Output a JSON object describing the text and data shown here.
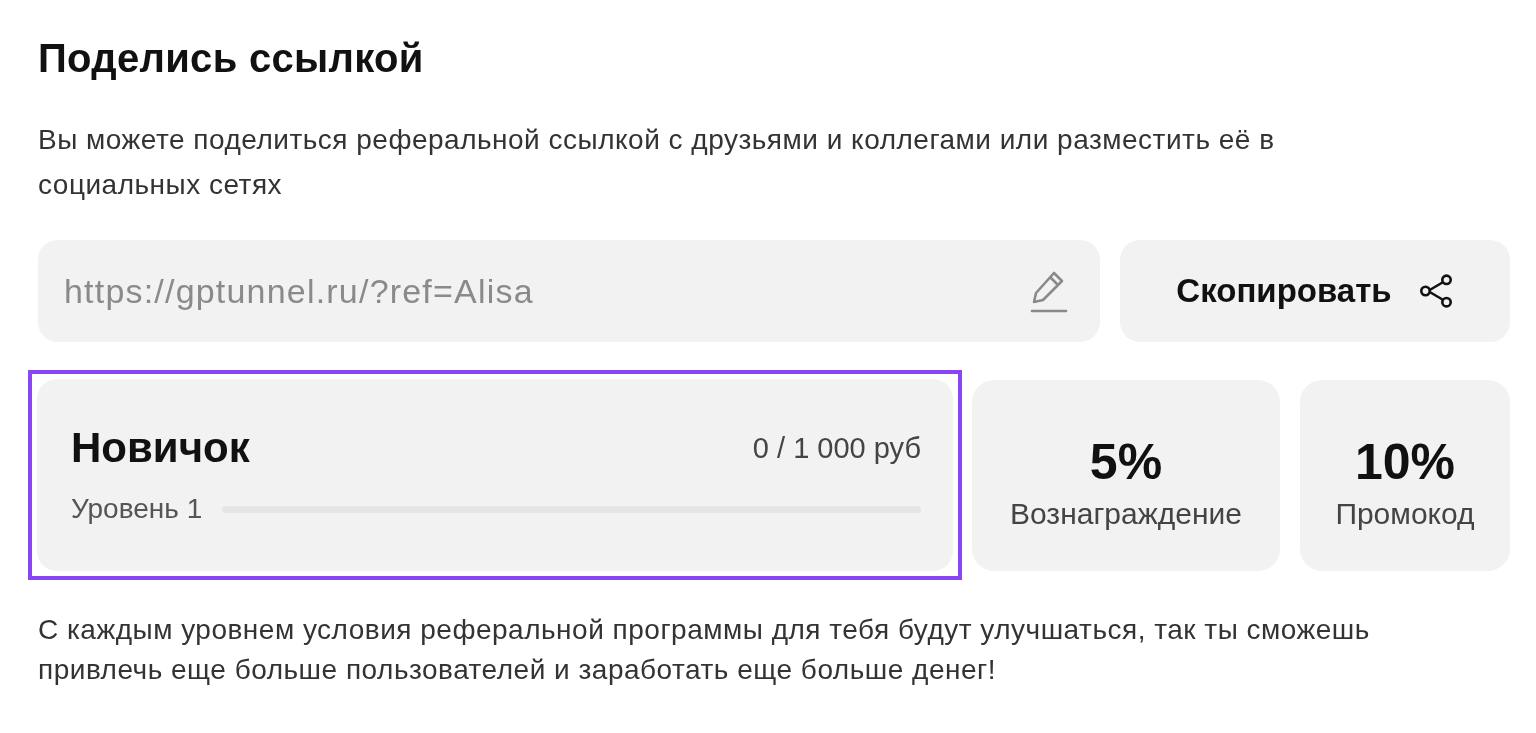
{
  "title": "Поделись ссылкой",
  "description": "Вы можете поделиться реферальной ссылкой с друзьями и коллегами или разместить её в социальных сетях",
  "link_field": {
    "value": "https://gptunnel.ru/?ref=Alisa"
  },
  "copy_button": {
    "label": "Скопировать"
  },
  "level_card": {
    "highlighted": true,
    "name": "Новичок",
    "progress": "0 / 1 000 руб",
    "level_label": "Уровень 1",
    "level": 0
  },
  "stats": [
    {
      "value": "5%",
      "label": "Вознаграждение"
    },
    {
      "value": "10%",
      "label": "Промокод"
    }
  ],
  "footer_text": "С каждым уровнем условия реферальной программы для тебя будут улучшаться, так ты сможешь привлечь еще больше пользователей и заработать еще больше денег!"
}
